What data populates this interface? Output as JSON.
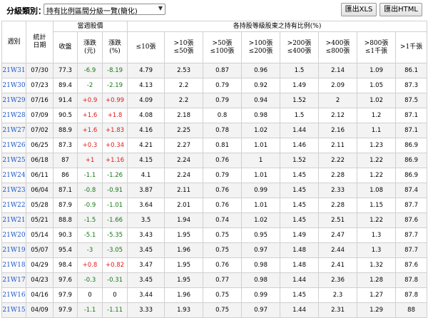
{
  "toolbar": {
    "category_label": "分級類別：",
    "category_value": "持有比例區間分級一覽(簡化)",
    "export_xls": "匯出XLS",
    "export_html": "匯出HTML"
  },
  "header": {
    "week": "週別",
    "date_l1": "統計",
    "date_l2": "日期",
    "price_group": "當週股價",
    "close": "收盤",
    "change_l1": "漲跌",
    "change_l2": "(元)",
    "pct_l1": "漲跌",
    "pct_l2": "(%)",
    "holder_group": "各持股等級股東之持有比例(%)",
    "levels": [
      {
        "l1": "≤10張",
        "l2": ""
      },
      {
        "l1": ">10張",
        "l2": "≤50張"
      },
      {
        "l1": ">50張",
        "l2": "≤100張"
      },
      {
        "l1": ">100張",
        "l2": "≤200張"
      },
      {
        "l1": ">200張",
        "l2": "≤400張"
      },
      {
        "l1": ">400張",
        "l2": "≤800張"
      },
      {
        "l1": ">800張",
        "l2": "≤1千張"
      },
      {
        "l1": ">1千張",
        "l2": ""
      }
    ]
  },
  "rows": [
    {
      "week": "21W31",
      "date": "07/30",
      "close": "77.3",
      "chg": "-6.9",
      "pct": "-8.19",
      "dir": "down",
      "lv": [
        "4.79",
        "2.53",
        "0.87",
        "0.96",
        "1.5",
        "2.14",
        "1.09",
        "86.1"
      ]
    },
    {
      "week": "21W30",
      "date": "07/23",
      "close": "89.4",
      "chg": "-2",
      "pct": "-2.19",
      "dir": "down",
      "lv": [
        "4.13",
        "2.2",
        "0.79",
        "0.92",
        "1.49",
        "2.09",
        "1.05",
        "87.3"
      ]
    },
    {
      "week": "21W29",
      "date": "07/16",
      "close": "91.4",
      "chg": "+0.9",
      "pct": "+0.99",
      "dir": "up",
      "lv": [
        "4.09",
        "2.2",
        "0.79",
        "0.94",
        "1.52",
        "2",
        "1.02",
        "87.5"
      ]
    },
    {
      "week": "21W28",
      "date": "07/09",
      "close": "90.5",
      "chg": "+1.6",
      "pct": "+1.8",
      "dir": "up",
      "lv": [
        "4.08",
        "2.18",
        "0.8",
        "0.98",
        "1.5",
        "2.12",
        "1.2",
        "87.1"
      ]
    },
    {
      "week": "21W27",
      "date": "07/02",
      "close": "88.9",
      "chg": "+1.6",
      "pct": "+1.83",
      "dir": "up",
      "lv": [
        "4.16",
        "2.25",
        "0.78",
        "1.02",
        "1.44",
        "2.16",
        "1.1",
        "87.1"
      ]
    },
    {
      "week": "21W26",
      "date": "06/25",
      "close": "87.3",
      "chg": "+0.3",
      "pct": "+0.34",
      "dir": "up",
      "lv": [
        "4.21",
        "2.27",
        "0.81",
        "1.01",
        "1.46",
        "2.11",
        "1.23",
        "86.9"
      ]
    },
    {
      "week": "21W25",
      "date": "06/18",
      "close": "87",
      "chg": "+1",
      "pct": "+1.16",
      "dir": "up",
      "lv": [
        "4.15",
        "2.24",
        "0.76",
        "1",
        "1.52",
        "2.22",
        "1.22",
        "86.9"
      ]
    },
    {
      "week": "21W24",
      "date": "06/11",
      "close": "86",
      "chg": "-1.1",
      "pct": "-1.26",
      "dir": "down",
      "lv": [
        "4.1",
        "2.24",
        "0.79",
        "1.01",
        "1.45",
        "2.28",
        "1.22",
        "86.9"
      ]
    },
    {
      "week": "21W23",
      "date": "06/04",
      "close": "87.1",
      "chg": "-0.8",
      "pct": "-0.91",
      "dir": "down",
      "lv": [
        "3.87",
        "2.11",
        "0.76",
        "0.99",
        "1.45",
        "2.33",
        "1.08",
        "87.4"
      ]
    },
    {
      "week": "21W22",
      "date": "05/28",
      "close": "87.9",
      "chg": "-0.9",
      "pct": "-1.01",
      "dir": "down",
      "lv": [
        "3.64",
        "2.01",
        "0.76",
        "1.01",
        "1.45",
        "2.28",
        "1.15",
        "87.7"
      ]
    },
    {
      "week": "21W21",
      "date": "05/21",
      "close": "88.8",
      "chg": "-1.5",
      "pct": "-1.66",
      "dir": "down",
      "lv": [
        "3.5",
        "1.94",
        "0.74",
        "1.02",
        "1.45",
        "2.51",
        "1.22",
        "87.6"
      ]
    },
    {
      "week": "21W20",
      "date": "05/14",
      "close": "90.3",
      "chg": "-5.1",
      "pct": "-5.35",
      "dir": "down",
      "lv": [
        "3.43",
        "1.95",
        "0.75",
        "0.95",
        "1.49",
        "2.47",
        "1.3",
        "87.7"
      ]
    },
    {
      "week": "21W19",
      "date": "05/07",
      "close": "95.4",
      "chg": "-3",
      "pct": "-3.05",
      "dir": "down",
      "lv": [
        "3.45",
        "1.96",
        "0.75",
        "0.97",
        "1.48",
        "2.44",
        "1.3",
        "87.7"
      ]
    },
    {
      "week": "21W18",
      "date": "04/29",
      "close": "98.4",
      "chg": "+0.8",
      "pct": "+0.82",
      "dir": "up",
      "lv": [
        "3.47",
        "1.95",
        "0.76",
        "0.98",
        "1.48",
        "2.41",
        "1.32",
        "87.6"
      ]
    },
    {
      "week": "21W17",
      "date": "04/23",
      "close": "97.6",
      "chg": "-0.3",
      "pct": "-0.31",
      "dir": "down",
      "lv": [
        "3.45",
        "1.95",
        "0.77",
        "0.98",
        "1.44",
        "2.36",
        "1.28",
        "87.8"
      ]
    },
    {
      "week": "21W16",
      "date": "04/16",
      "close": "97.9",
      "chg": "0",
      "pct": "0",
      "dir": "flat",
      "lv": [
        "3.44",
        "1.96",
        "0.75",
        "0.99",
        "1.45",
        "2.3",
        "1.27",
        "87.8"
      ]
    },
    {
      "week": "21W15",
      "date": "04/09",
      "close": "97.9",
      "chg": "-1.1",
      "pct": "-1.11",
      "dir": "down",
      "lv": [
        "3.33",
        "1.93",
        "0.75",
        "0.97",
        "1.44",
        "2.31",
        "1.29",
        "88"
      ]
    }
  ],
  "colors": {
    "week_link": "#1a55c8",
    "up": "#e21a1a",
    "down": "#157a15",
    "row_alt": "#f3f3f3",
    "border": "#d0d0d0"
  },
  "icons": {
    "select_arrow": "chevron-down-icon"
  }
}
